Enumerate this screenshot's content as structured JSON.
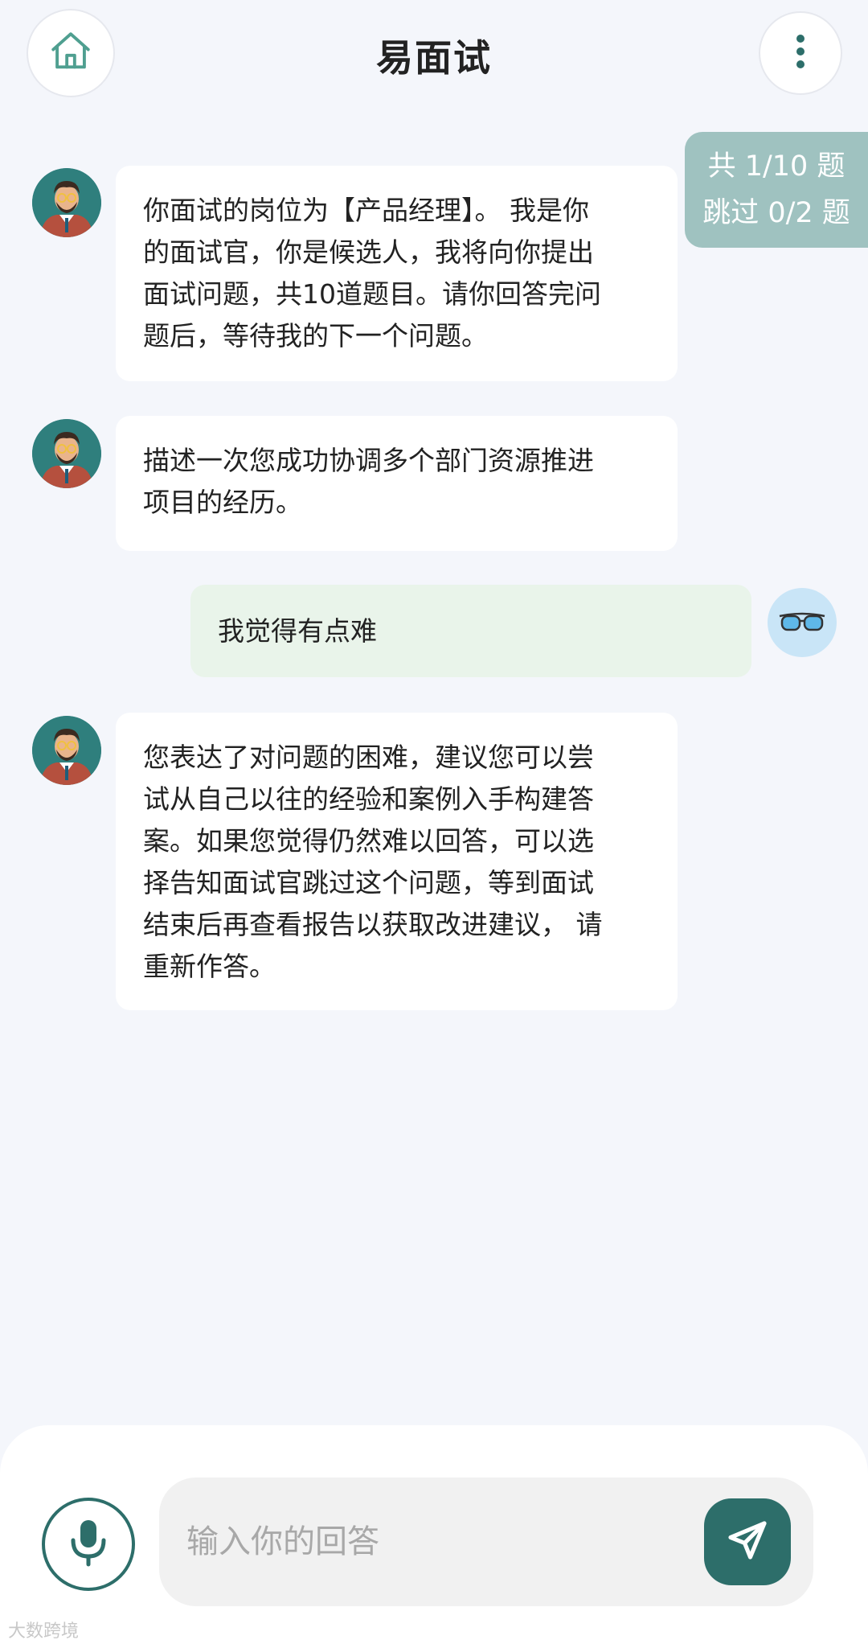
{
  "header": {
    "title": "易面试",
    "home_icon": "home-icon",
    "menu_icon": "more-vertical-icon"
  },
  "progress": {
    "total_line": "共 1/10 题",
    "skip_line": "跳过 0/2 题"
  },
  "messages": [
    {
      "sender": "interviewer",
      "lines": [
        "你面试的岗位为【产品经理】。 我是你",
        "的面试官，你是候选人，我将向你提出",
        "面试问题，共10道题目。请你回答完问",
        "题后，等待我的下一个问题。"
      ]
    },
    {
      "sender": "interviewer",
      "lines": [
        "描述一次您成功协调多个部门资源推进",
        "项目的经历。"
      ]
    },
    {
      "sender": "user",
      "text": "我觉得有点难"
    },
    {
      "sender": "interviewer",
      "lines": [
        "您表达了对问题的困难，建议您可以尝",
        "试从自己以往的经验和案例入手构建答",
        "案。如果您觉得仍然难以回答，可以选",
        "择告知面试官跳过这个问题，等到面试",
        "结束后再查看报告以获取改进建议， 请",
        "重新作答。"
      ]
    }
  ],
  "input": {
    "placeholder": "输入你的回答",
    "mic_icon": "microphone-icon",
    "send_icon": "send-icon"
  },
  "watermark": "大数跨境",
  "colors": {
    "accent": "#2d6e6a",
    "badge": "#9fc2c0",
    "user_bubble": "#e9f4ea",
    "background": "#f4f6fb"
  }
}
